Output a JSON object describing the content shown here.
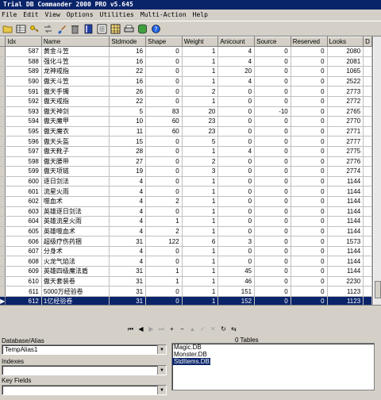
{
  "window": {
    "title": "Trial DB Commander 2000 PRO v5.645"
  },
  "menu": [
    "File",
    "Edit",
    "View",
    "Options",
    "Utilities",
    "Multi-Action",
    "Help"
  ],
  "toolbar": {
    "icons": [
      "open-folder-icon",
      "table-icon",
      "key-icon",
      "arrows-icon",
      "brush-icon",
      "trash-icon",
      "book-icon",
      "list-icon",
      "grid-icon",
      "print-icon",
      "sql-icon",
      "help-icon"
    ]
  },
  "grid": {
    "columns": [
      "Idx",
      "Name",
      "Stdmode",
      "Shape",
      "Weight",
      "Anicount",
      "Source",
      "Reserved",
      "Looks",
      "D"
    ],
    "rows": [
      [
        "587",
        "黄金斗笠",
        "16",
        "0",
        "1",
        "4",
        "0",
        "0",
        "2080"
      ],
      [
        "588",
        "强化斗笠",
        "16",
        "0",
        "1",
        "4",
        "0",
        "0",
        "2081"
      ],
      [
        "589",
        "龙神戒指",
        "22",
        "0",
        "1",
        "20",
        "0",
        "0",
        "1065"
      ],
      [
        "590",
        "傲天斗笠",
        "16",
        "0",
        "1",
        "4",
        "0",
        "0",
        "2522"
      ],
      [
        "591",
        "傲天手镯",
        "26",
        "0",
        "2",
        "0",
        "0",
        "0",
        "2773"
      ],
      [
        "592",
        "傲天戒指",
        "22",
        "0",
        "1",
        "0",
        "0",
        "0",
        "2772"
      ],
      [
        "593",
        "傲天神剑",
        "5",
        "83",
        "20",
        "0",
        "-10",
        "0",
        "2765"
      ],
      [
        "594",
        "傲天魔甲",
        "10",
        "60",
        "23",
        "0",
        "0",
        "0",
        "2770"
      ],
      [
        "595",
        "傲天魔衣",
        "11",
        "60",
        "23",
        "0",
        "0",
        "0",
        "2771"
      ],
      [
        "596",
        "傲天头盔",
        "15",
        "0",
        "5",
        "0",
        "0",
        "0",
        "2777"
      ],
      [
        "597",
        "傲天靴子",
        "28",
        "0",
        "1",
        "4",
        "0",
        "0",
        "2775"
      ],
      [
        "598",
        "傲天腰带",
        "27",
        "0",
        "2",
        "0",
        "0",
        "0",
        "2776"
      ],
      [
        "599",
        "傲天项链",
        "19",
        "0",
        "3",
        "0",
        "0",
        "0",
        "2774"
      ],
      [
        "600",
        "逐日剑法",
        "4",
        "0",
        "1",
        "0",
        "0",
        "0",
        "1144"
      ],
      [
        "601",
        "流星火雨",
        "4",
        "0",
        "1",
        "0",
        "0",
        "0",
        "1144"
      ],
      [
        "602",
        "噬血术",
        "4",
        "2",
        "1",
        "0",
        "0",
        "0",
        "1144"
      ],
      [
        "603",
        "英雄逐日剑法",
        "4",
        "0",
        "1",
        "0",
        "0",
        "0",
        "1144"
      ],
      [
        "604",
        "英雄流星火雨",
        "4",
        "1",
        "1",
        "0",
        "0",
        "0",
        "1144"
      ],
      [
        "605",
        "英雄噬血术",
        "4",
        "2",
        "1",
        "0",
        "0",
        "0",
        "1144"
      ],
      [
        "606",
        "超级疗伤药捆",
        "31",
        "122",
        "6",
        "3",
        "0",
        "0",
        "1573"
      ],
      [
        "607",
        "分身术",
        "4",
        "0",
        "1",
        "0",
        "0",
        "0",
        "1144"
      ],
      [
        "608",
        "火龙气焰法",
        "4",
        "0",
        "1",
        "0",
        "0",
        "0",
        "1144"
      ],
      [
        "609",
        "英雄四级魔法盾",
        "31",
        "1",
        "1",
        "45",
        "0",
        "0",
        "1144"
      ],
      [
        "610",
        "傲天套装卷",
        "31",
        "1",
        "1",
        "46",
        "0",
        "0",
        "2230"
      ],
      [
        "611",
        "5000万经验卷",
        "31",
        "0",
        "1",
        "151",
        "0",
        "0",
        "1123"
      ],
      [
        "612",
        "1亿经验卷",
        "31",
        "0",
        "1",
        "152",
        "0",
        "0",
        "1123"
      ]
    ],
    "selected_row_marker": "▶"
  },
  "navigator": {
    "buttons": [
      "first",
      "prior",
      "next",
      "last",
      "insert",
      "delete",
      "edit",
      "post",
      "cancel",
      "refresh",
      "bookmark"
    ],
    "glyphs": [
      "⏮",
      "◀",
      "▶",
      "⏭",
      "+",
      "−",
      "▲",
      "✓",
      "✕",
      "↻",
      "⇆"
    ]
  },
  "database_panel": {
    "database_label": "Database/Alias",
    "database_value": "TempAlias1",
    "indexes_label": "Indexes",
    "indexes_value": "",
    "keyfields_label": "Key Fields",
    "keyfields_value": ""
  },
  "tables_panel": {
    "count_label": "0 Tables",
    "tables": [
      "Magic.DB",
      "Monster.DB",
      "StdItems.DB"
    ],
    "selected_index": 2
  }
}
